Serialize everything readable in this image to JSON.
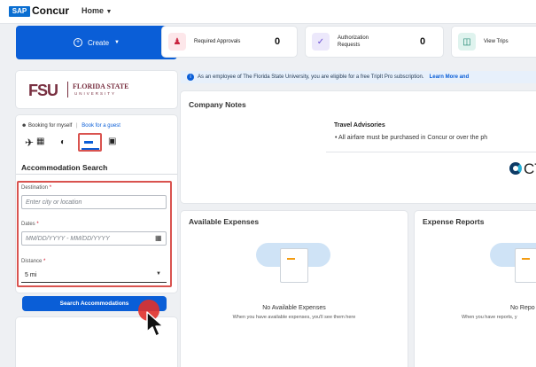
{
  "header": {
    "sap_logo_text": "SAP",
    "brand": "Concur",
    "home_menu": "Home"
  },
  "quick_actions": {
    "create_label": "Create",
    "required_approvals": {
      "label": "Required Approvals",
      "count": "0"
    },
    "authorization_requests": {
      "label_line1": "Authorization",
      "label_line2": "Requests",
      "count": "0"
    },
    "view_trips": {
      "label": "View Trips"
    }
  },
  "org_logo": {
    "initials": "FSU",
    "name_line1": "FLORIDA STATE",
    "name_line2": "UNIVERSITY"
  },
  "booking": {
    "booking_for_myself": "Booking for myself",
    "separator": "|",
    "book_for_guest": "Book for a guest",
    "heading": "Accommodation Search",
    "destination_label": "Destination",
    "destination_placeholder": "Enter city or location",
    "dates_label": "Dates",
    "dates_placeholder": "MM/DD/YYYY - MM/DD/YYYY",
    "distance_label": "Distance",
    "distance_value": "5 mi",
    "required_mark": "*",
    "search_button": "Search Accommodations"
  },
  "banner": {
    "text": "As an employee of The Florida State University, you are eligible for a free TripIt Pro subscription.",
    "link": "Learn More and"
  },
  "company_notes": {
    "title": "Company Notes",
    "advisory_title": "Travel Advisories",
    "advisory_item": "All airfare must be purchased in Concur or over the ph",
    "partner_logo_text": "CT"
  },
  "available_expenses": {
    "title": "Available Expenses",
    "empty_title": "No Available Expenses",
    "empty_sub": "When you have available expenses, you'll see them here"
  },
  "expense_reports": {
    "title": "Expense Reports",
    "empty_title": "No Repo",
    "empty_sub": "When you have reports, y"
  },
  "colors": {
    "primary": "#0a5ed7",
    "highlight": "#d9534f",
    "cursor_dot": "#e0312b"
  }
}
